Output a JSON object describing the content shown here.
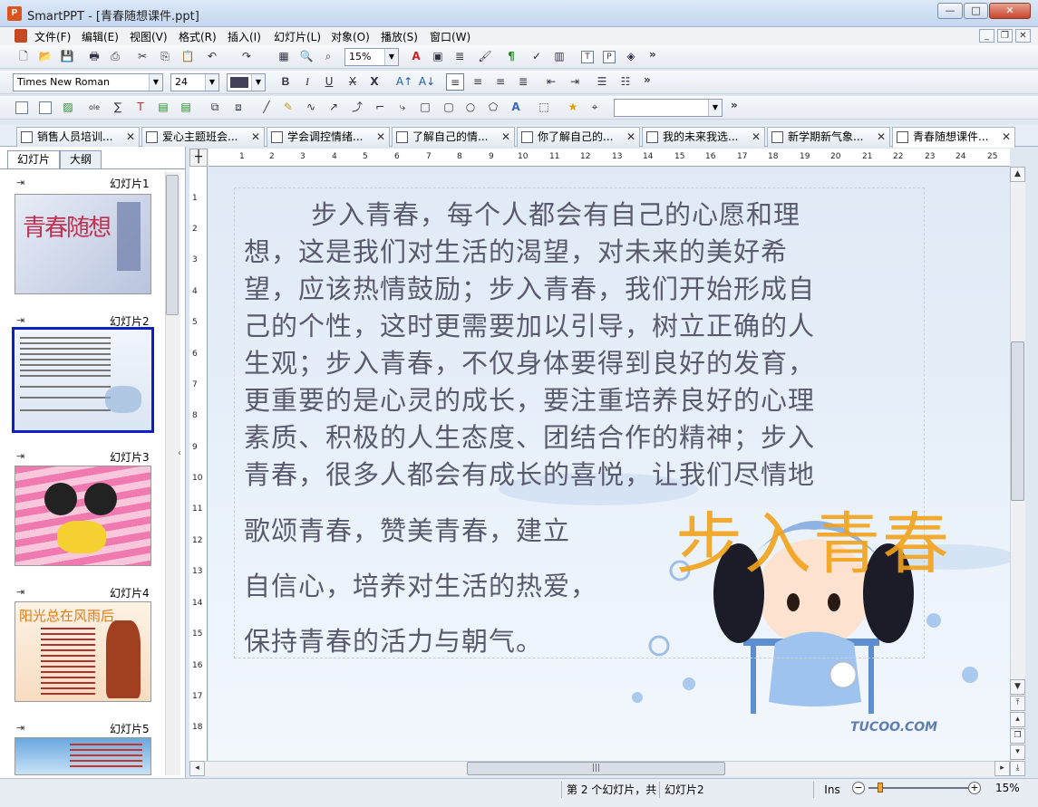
{
  "window": {
    "title": "SmartPPT - [青春随想课件.ppt]",
    "app_icon": "P"
  },
  "menu": [
    "文件(F)",
    "编辑(E)",
    "视图(V)",
    "格式(R)",
    "插入(I)",
    "幻灯片(L)",
    "对象(O)",
    "播放(S)",
    "窗口(W)"
  ],
  "toolbar": {
    "zoom": "15%",
    "font": "Times New Roman",
    "size": "24",
    "more": "»"
  },
  "tabs": [
    "销售人员培训...",
    "爱心主题班会...",
    "学会调控情绪...",
    "了解自己的情...",
    "你了解自己的...",
    "我的未来我选...",
    "新学期新气象...",
    "青春随想课件..."
  ],
  "close_glyph": "✕",
  "panel_tabs": [
    "幻灯片",
    "大纲"
  ],
  "slides": [
    "幻灯片1",
    "幻灯片2",
    "幻灯片3",
    "幻灯片4",
    "幻灯片5"
  ],
  "thumbs": {
    "t1_title": "青春随想",
    "t4_title": "阳光总在风雨后"
  },
  "slide": {
    "lines": [
      "步入青春，每个人都会有自己的心愿和理",
      "想，这是我们对生活的渴望，对未来的美好希",
      "望，应该热情鼓励；步入青春，我们开始形成自",
      "己的个性，这时更需要加以引导，树立正确的人",
      "生观；步入青春，不仅身体要得到良好的发育，",
      "更重要的是心灵的成长，要注重培养良好的心理",
      "素质、积极的人生态度、团结合作的精神；步入",
      "青春，很多人都会有成长的喜悦，让我们尽情地",
      "歌颂青春，赞美青春，建立",
      "自信心，培养对生活的热爱，",
      "保持青春的活力与朝气。"
    ],
    "big_title": "步入青春",
    "watermark": "TUCOO.COM"
  },
  "ruler_h": [
    "1",
    "2",
    "3",
    "4",
    "5",
    "6",
    "7",
    "8",
    "9",
    "10",
    "11",
    "12",
    "13",
    "14",
    "15",
    "16",
    "17",
    "18",
    "19",
    "20",
    "21",
    "22",
    "23",
    "24",
    "25"
  ],
  "ruler_v": [
    "1",
    "2",
    "3",
    "4",
    "5",
    "6",
    "7",
    "8",
    "9",
    "10",
    "11",
    "12",
    "13",
    "14",
    "15",
    "16",
    "17",
    "18"
  ],
  "status": {
    "position": "第 2 个幻灯片，共",
    "slide_name": "幻灯片2",
    "mode": "Ins",
    "zoom": "15%"
  },
  "colors": {
    "accent": "#1020c0",
    "title_orange": "#f3a21a"
  }
}
